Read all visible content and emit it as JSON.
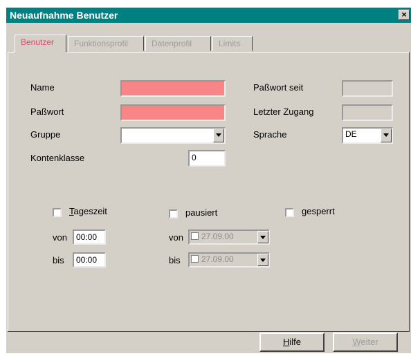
{
  "window": {
    "title": "Neuaufnahme Benutzer",
    "close_glyph": "×"
  },
  "tabs": [
    {
      "label": "Benutzer",
      "active": true
    },
    {
      "label": "Funktionsprofil",
      "active": false
    },
    {
      "label": "Datenprofil",
      "active": false
    },
    {
      "label": "Limits",
      "active": false
    }
  ],
  "form": {
    "name_label": "Name",
    "name_value": "",
    "password_label": "Paßwort",
    "password_value": "",
    "group_label": "Gruppe",
    "group_value": "",
    "account_class_label": "Kontenklasse",
    "account_class_value": "0",
    "password_since_label": "Paßwort seit",
    "password_since_value": "",
    "last_access_label": "Letzter Zugang",
    "last_access_value": "",
    "language_label": "Sprache",
    "language_value": "DE"
  },
  "options": {
    "daytime": {
      "label_underlined": "T",
      "label_rest": "ageszeit",
      "checked": false,
      "from_label": "von",
      "from_value": "00:00",
      "to_label": "bis",
      "to_value": "00:00"
    },
    "paused": {
      "label": "pausiert",
      "checked": false,
      "from_label": "von",
      "from_value": "27.09.00",
      "to_label": "bis",
      "to_value": "27.09.00"
    },
    "locked": {
      "label": "gesperrt",
      "checked": false
    }
  },
  "buttons": {
    "help": {
      "label_underlined": "H",
      "label_rest": "ilfe"
    },
    "next": {
      "label_underlined": "W",
      "label_rest": "eiter",
      "disabled": true
    }
  },
  "colors": {
    "titlebar": "#008080",
    "required_field": "#f98686",
    "active_tab_text": "#e0486c"
  }
}
